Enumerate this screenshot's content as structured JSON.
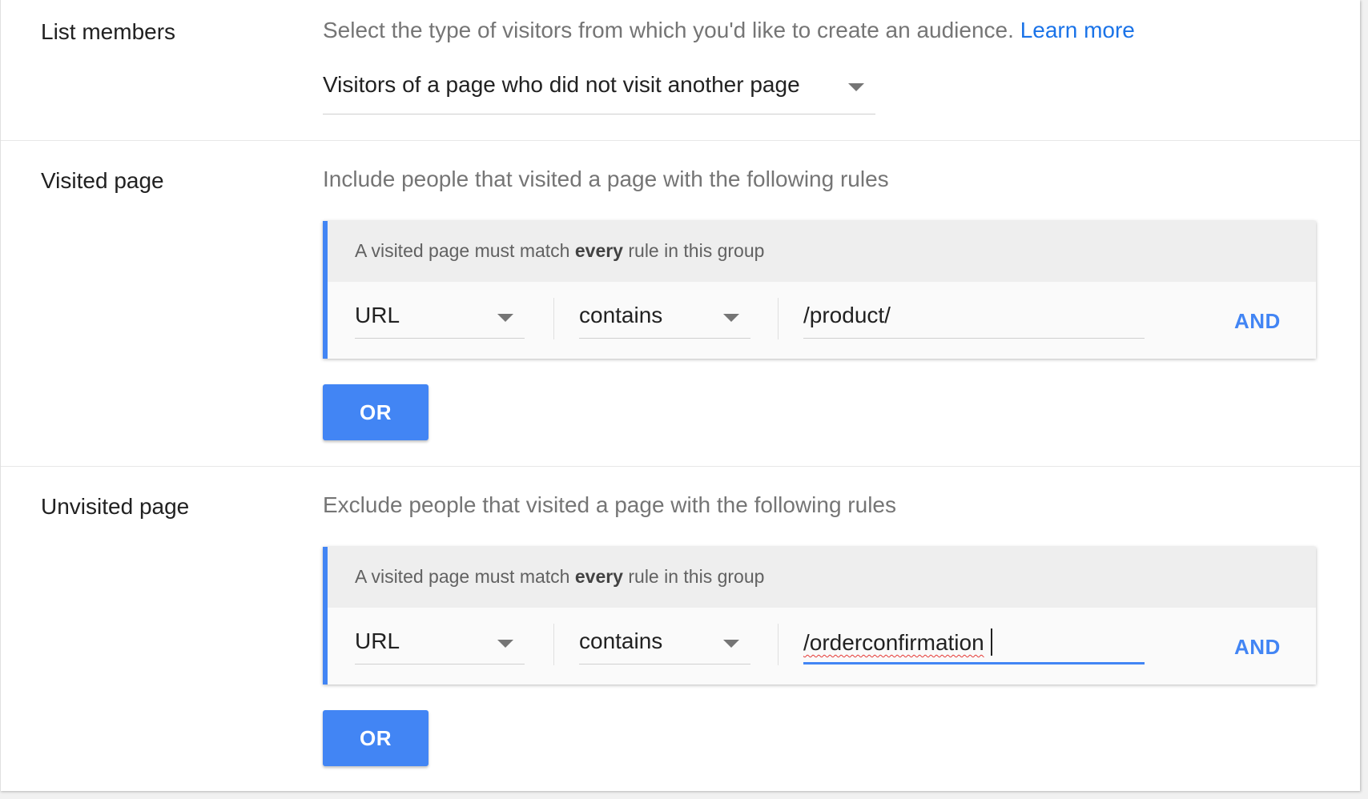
{
  "list_members": {
    "label": "List members",
    "description": "Select the type of visitors from which you'd like to create an audience.",
    "learn_more": "Learn more",
    "selected_type": "Visitors of a page who did not visit another page"
  },
  "visited": {
    "label": "Visited page",
    "description": "Include people that visited a page with the following rules",
    "group_header_prefix": "A visited page must match",
    "group_header_bold": "every",
    "group_header_suffix": "rule in this group",
    "rule": {
      "field": "URL",
      "operator": "contains",
      "value": "/product/"
    },
    "and_label": "AND",
    "or_label": "OR"
  },
  "unvisited": {
    "label": "Unvisited page",
    "description": "Exclude people that visited a page with the following rules",
    "group_header_prefix": "A visited page must match",
    "group_header_bold": "every",
    "group_header_suffix": "rule in this group",
    "rule": {
      "field": "URL",
      "operator": "contains",
      "value": "/orderconfirmation"
    },
    "and_label": "AND",
    "or_label": "OR"
  },
  "colors": {
    "accent": "#4285f4",
    "link": "#1a73e8",
    "spellcheck": "#e53935"
  }
}
